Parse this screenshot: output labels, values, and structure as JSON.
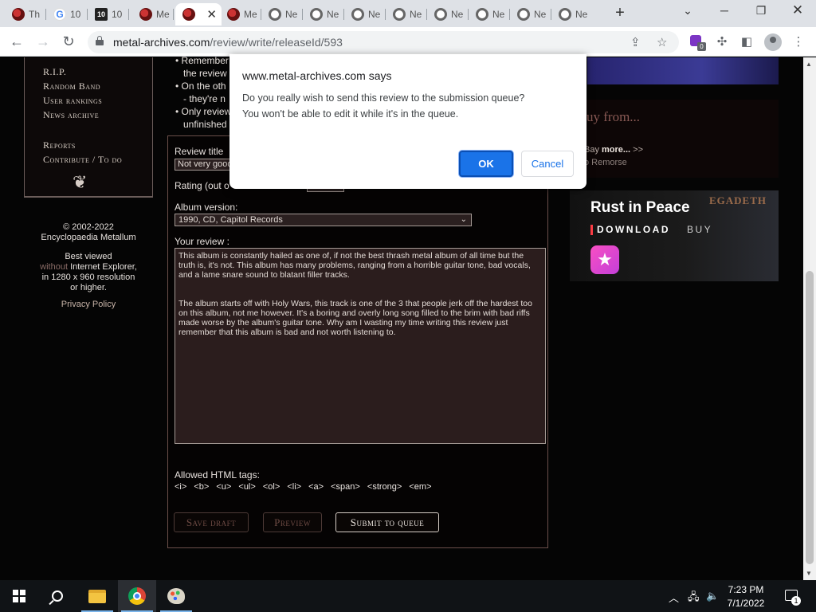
{
  "browser": {
    "tabs": [
      {
        "icon": "metal-archives-icon",
        "title": "Th"
      },
      {
        "icon": "google-icon",
        "title": "10"
      },
      {
        "icon": "ten-icon",
        "title": "10"
      },
      {
        "icon": "metal-archives-icon",
        "title": "Me"
      },
      {
        "icon": "metal-archives-icon",
        "title": "",
        "active": true
      },
      {
        "icon": "metal-archives-icon",
        "title": "Me"
      },
      {
        "icon": "chrome-page-icon",
        "title": "Ne"
      },
      {
        "icon": "chrome-page-icon",
        "title": "Ne"
      },
      {
        "icon": "chrome-page-icon",
        "title": "Ne"
      },
      {
        "icon": "chrome-page-icon",
        "title": "Ne"
      },
      {
        "icon": "chrome-page-icon",
        "title": "Ne"
      },
      {
        "icon": "chrome-page-icon",
        "title": "Ne"
      },
      {
        "icon": "chrome-page-icon",
        "title": "Ne"
      },
      {
        "icon": "chrome-page-icon",
        "title": "Ne"
      }
    ],
    "url_host": "metal-archives.com",
    "url_path": "/review/write/releaseId/593",
    "extension_badge": "0"
  },
  "sidebar": {
    "menu_items": [
      "R.I.P.",
      "Random Band",
      "User rankings",
      "News archive",
      "Reports",
      "Contribute / To do"
    ],
    "copyright": "© 2002-2022",
    "site_name": "Encyclopaedia Metallum",
    "best_viewed": "Best viewed",
    "without": "without",
    "ie": "Internet Explorer,",
    "resolution": "in 1280 x 960 resolution",
    "or_higher": "or higher.",
    "privacy": "Privacy Policy"
  },
  "rules": {
    "line1": "• Remember",
    "line2": "the review",
    "line3": "• On the oth",
    "line4": "- they're n",
    "line5": "• Only review",
    "line6": "unfinished"
  },
  "form": {
    "review_title_label": "Review title",
    "review_title_value": "Not very good",
    "rating_label": "Rating (out o",
    "album_version_label": "Album version:",
    "album_version_value": "1990, CD, Capitol Records",
    "your_review_label": "Your review :",
    "review_paragraph_1": "This album is constantly hailed as one of, if not the best thrash metal album of all time but the truth is, it's not. This album has many problems, ranging from a horrible guitar tone, bad vocals, and a lame snare sound to blatant filler tracks.",
    "review_paragraph_2": "The album starts off with Holy Wars, this track is one of the 3 that people jerk off the hardest too on this album, not me however. It's a boring and overly long song filled to the brim with bad riffs made worse by the album's guitar tone. Why am I wasting my time writing this review just remember that this album is bad and not worth listening to.",
    "allowed_tags_label": "Allowed HTML tags:",
    "allowed_tags": "<i> <b> <u> <ul> <ol> <li> <a> <span> <strong> <em>",
    "save_draft": "Save draft",
    "preview": "Preview",
    "submit": "Submit to queue"
  },
  "right_column": {
    "buy_title": "uy from...",
    "buy_line1_prefix": "Bay",
    "buy_line1_more": "more...",
    "buy_line1_suffix": ">>",
    "buy_line2": "o Remorse",
    "ad_title": "Rust in Peace",
    "ad_download": "DOWNLOAD",
    "ad_buy": "BUY",
    "ad_band": "EGADETH"
  },
  "dialog": {
    "title": "www.metal-archives.com says",
    "message_line1": "Do you really wish to send this review to the submission queue?",
    "message_line2": "You won't be able to edit it while it's in the queue.",
    "ok": "OK",
    "cancel": "Cancel"
  },
  "taskbar": {
    "time": "7:23 PM",
    "date": "7/1/2022",
    "notification_count": "1"
  }
}
